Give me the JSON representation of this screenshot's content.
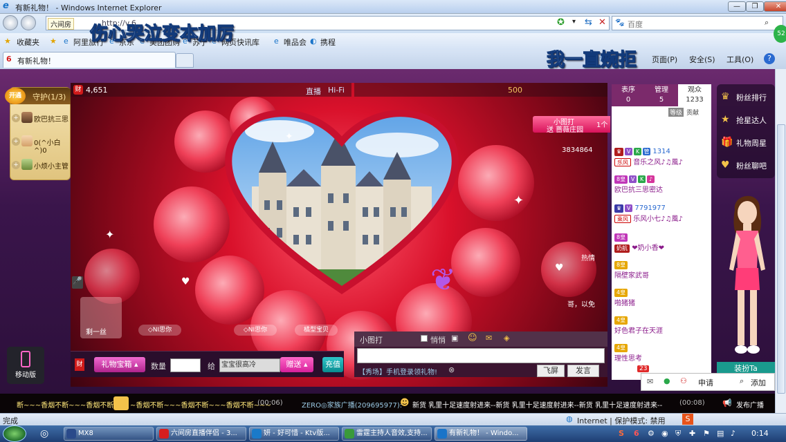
{
  "window": {
    "title": "有新礼物！ - Windows Internet Explorer"
  },
  "addressbar": {
    "url_tag": "六间房",
    "search_engine_label": "百度",
    "url_partial": "http://v.6"
  },
  "favorites": {
    "label": "收藏夹",
    "items": [
      "阿里旅行",
      "京东",
      "美团团购",
      "苏宁",
      "网页快讯库",
      "唯品会",
      "携程"
    ]
  },
  "tab": {
    "label": "有新礼物！"
  },
  "commandbar": {
    "page_menu": "页面(P)",
    "safety_menu": "安全(S)",
    "tools_menu": "工具(O)",
    "help_icon": "?"
  },
  "overlay_text": {
    "top_left": "伤心哭泣变本加厉",
    "top_right": "我一直婉拒"
  },
  "room": {
    "guard_panel": {
      "open_label": "开通",
      "title": "守护(1/3)",
      "members": [
        "欧巴抗三思",
        "0(^小白^)0",
        "小烦小主管"
      ]
    },
    "wealth_label": "财",
    "wealth_count": "4,651",
    "video_labels": [
      "直播",
      "Hi-Fi"
    ],
    "chat_header": {
      "count": "500",
      "guard_link": "团护卫"
    },
    "gift_event": {
      "small": "小图打",
      "text": "送 蔷薇庄园",
      "suffix": "1个"
    },
    "side_number": "3834864",
    "gift_slots": [
      "剩一丝",
      "◇NI思你",
      "◇NI思你",
      "橘型宝贝"
    ],
    "chat_fragments": [
      "热情",
      "哥，以免"
    ]
  },
  "giftbar": {
    "wealth_icon": "财",
    "gift_select": "礼物宝箱",
    "qty_label": "数量",
    "to_label": "给",
    "recipient": "宝宝很高冷",
    "send_label": "赠送",
    "charge_label": "充值"
  },
  "chat_input": {
    "tool_label_1": "小图打",
    "tool_label_2": "悄悄",
    "promo": "【秀场】手机登录领礼物!",
    "fly_screen": "飞屏",
    "send": "发言"
  },
  "audience_panel": {
    "tabs": [
      {
        "label": "表序",
        "count": "0"
      },
      {
        "label": "管理",
        "count": "5"
      },
      {
        "label": "观众",
        "count": "1233"
      }
    ],
    "sort_labels": [
      "等级",
      "贡献"
    ],
    "users": [
      {
        "id": "1314",
        "tag": "乐风",
        "name": "音乐之风♪♫風♪",
        "badge": ""
      },
      {
        "id": "",
        "tag": "8皇",
        "name": "欧巴抗三思密达",
        "badge": ""
      },
      {
        "id": "7791977",
        "tag": "乘风",
        "name": "乐风小七♪♫風♪",
        "badge": ""
      },
      {
        "id": "",
        "tag": "奶航",
        "name": "❤奶小香❤",
        "badge": "8皇"
      },
      {
        "id": "",
        "tag": "",
        "name": "隔壁家武哥",
        "badge": "8皇"
      },
      {
        "id": "",
        "tag": "",
        "name": "啪猪猪",
        "badge": "4皇"
      },
      {
        "id": "",
        "tag": "",
        "name": "好色君子在天涯",
        "badge": "4皇"
      },
      {
        "id": "",
        "tag": "",
        "name": "理性思考",
        "badge": "4皇"
      }
    ]
  },
  "right_menu": {
    "items": [
      {
        "icon": "crown-icon",
        "label": "粉丝排行"
      },
      {
        "icon": "star-icon",
        "label": "抢星达人"
      },
      {
        "icon": "gift-icon",
        "label": "礼物周星"
      },
      {
        "icon": "heart-icon",
        "label": "粉丝聊吧"
      }
    ],
    "dress_button": "装扮Ta"
  },
  "mobile_label": "移动版",
  "popup": {
    "badge_count": "23",
    "apply_label": "申请",
    "add_label": "添加"
  },
  "ticker": {
    "part1": "断~~~香烟不断~~~香烟不断~",
    "part2": "~香烟不断~~~香烟不断~~~香烟不断~~~",
    "time1": "(00:06)",
    "user": "ZERO◎家族广播(209695977):",
    "message": "新货 乳里十足速度射进来--新货 乳里十足速度射进来--新货 乳里十足速度射进来--",
    "time2": "(00:08)",
    "broadcast_btn": "发布广播"
  },
  "statusbar": {
    "left": "完成",
    "zone": "Internet | 保护模式: 禁用"
  },
  "taskbar": {
    "buttons": [
      "MX8",
      "六间房直播伴侣 - 3...",
      "妍 - 好可惜 - Ktv版...",
      "雷霆主持人音效,支持...",
      "有新礼物！ - Windo..."
    ],
    "clock": "0:14"
  }
}
